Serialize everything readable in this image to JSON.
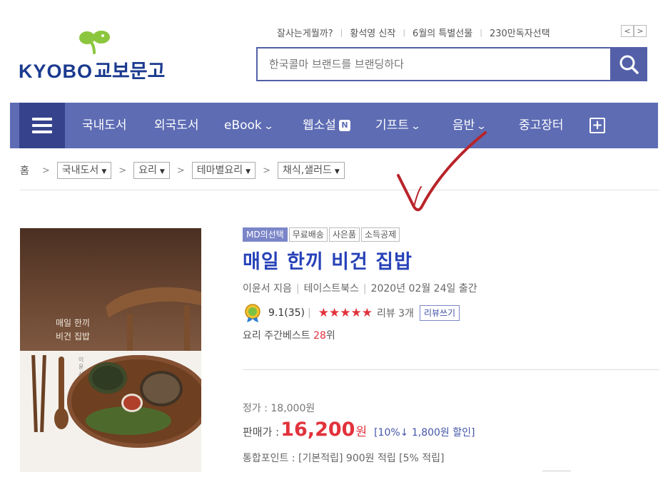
{
  "header": {
    "logo_text": "KYOBO",
    "logo_korean": "교보문고",
    "top_links": [
      "잘사는게뭘까?",
      "황석영 신작",
      "6월의 특별선물",
      "230만독자선택"
    ],
    "pager_prev": "<",
    "pager_next": ">",
    "search_placeholder": "한국콜마 브랜드를 브랜딩하다"
  },
  "nav": {
    "items": [
      {
        "label": "국내도서"
      },
      {
        "label": "외국도서"
      },
      {
        "label": "eBook"
      },
      {
        "label": "웹소설",
        "badge": "N"
      },
      {
        "label": "기프트"
      },
      {
        "label": "음반"
      },
      {
        "label": "중고장터"
      }
    ],
    "plus_label": "+"
  },
  "breadcrumb": {
    "home": "홈",
    "levels": [
      "국내도서",
      "요리",
      "테마별요리",
      "채식,샐러드"
    ]
  },
  "book": {
    "cover_title_line1": "매일 한끼",
    "cover_title_line2": "비건 집밥",
    "cover_author_vertical": "이윤서 지음",
    "badges": [
      "MD의선택",
      "무료배송",
      "사은품",
      "소득공제"
    ],
    "title": "매일 한끼 비건 집밥",
    "author": "이윤서 지음",
    "publisher": "테이스트북스",
    "pub_date": "2020년 02월 24일 출간",
    "rating": "9.1",
    "rating_count": "(35)",
    "stars": "★★★★★",
    "review_count": "리뷰 3개",
    "review_button": "리뷰쓰기",
    "rank_prefix": "요리 주간베스트 ",
    "rank_number": "28",
    "rank_suffix": "위",
    "list_price": "정가 : 18,000원",
    "sale_label": "판매가 : ",
    "sale_price": "16,200",
    "sale_won": "원",
    "discount": "[10%↓ 1,800원 할인]",
    "points": "통합포인트 : [기본적립] 900원 적립 [5% 적립]"
  },
  "colors": {
    "brand_blue": "#1b3a8f",
    "nav_bg": "#5d6cb3",
    "nav_menu_bg": "#36438c",
    "title_blue": "#2742b8",
    "price_red": "#e2323c",
    "check_red": "#b8242a"
  }
}
